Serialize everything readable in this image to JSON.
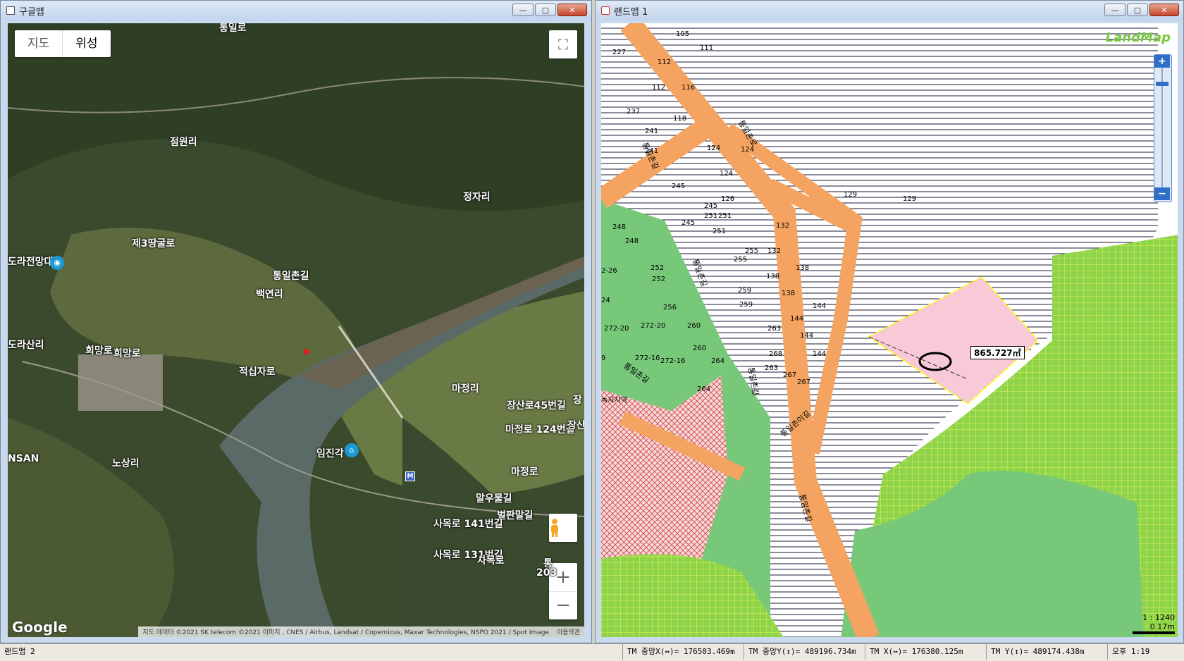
{
  "left_window": {
    "title": "구글맵",
    "buttons": {
      "minimize": "—",
      "maximize": "▢",
      "close": "✕"
    },
    "map_type": {
      "map": "지도",
      "satellite": "위성"
    },
    "places": [
      "통일로",
      "점원리",
      "정자리",
      "제3땅굴로",
      "도라전망대",
      "통일촌길",
      "백연리",
      "도라산리",
      "희망로",
      "희망로",
      "적십자로",
      "마정리",
      "장산로45번길",
      "마정로 124번길",
      "NSAN",
      "노상리",
      "임진각",
      "마정로",
      "말우물길",
      "벌판말길",
      "사목로 141번길",
      "사목로 131번길",
      "사목로",
      "장",
      "장산",
      "통",
      "203"
    ],
    "metro_badge": "M",
    "logo": "Google",
    "attribution": "지도 데이터 ©2021 SK telecom ©2021 이미지 , CNES / Airbus, Landsat / Copernicus, Maxar Technologies, NSPO 2021 / Spot Image",
    "terms": "이용약관",
    "zoom": {
      "plus": "+",
      "minus": "−"
    },
    "fullscreen": "⛶"
  },
  "right_window": {
    "title": "랜드맵 1",
    "buttons": {
      "minimize": "—",
      "maximize": "▢",
      "close": "✕"
    },
    "logo": "LandMap",
    "zoom": {
      "plus": "+",
      "minus": "−"
    },
    "parcel_labels": [
      "105",
      "111",
      "227",
      "112",
      "112",
      "116",
      "237",
      "118",
      "241",
      "241",
      "124",
      "124",
      "124",
      "245",
      "126",
      "245",
      "251",
      "251",
      "129",
      "129",
      "248",
      "245",
      "132",
      "248",
      "251",
      "255",
      "132",
      "252",
      "255",
      "138",
      "138",
      "2-26",
      "252",
      "259",
      "138",
      "256",
      "259",
      "144",
      "24",
      "272-20",
      "272-20",
      "260",
      "144",
      "263",
      "144",
      "9",
      "260",
      "272-16",
      "272-16",
      "264",
      "268",
      "144",
      "263",
      "264",
      "267",
      "267"
    ],
    "road_labels": [
      "통일촌길",
      "통일촌길",
      "통일촌길",
      "통일촌길",
      "통일촌로",
      "통일촌길",
      "통일촌이길"
    ],
    "zone_label": "녹지지역",
    "measurement": "865.727㎡",
    "scale": {
      "ratio": "1 : 1240",
      "bar_label": "0   17m"
    }
  },
  "status_bar": {
    "app": "랜드맵 2",
    "tmx_center": "TM 중앙X(↔)= 176503.469m",
    "tmy_center": "TM 중앙Y(↕)= 489196.734m",
    "tmx": "TM X(↔)= 176380.125m",
    "tmy": "TM Y(↕)= 489174.438m",
    "time": "오후 1:19"
  }
}
